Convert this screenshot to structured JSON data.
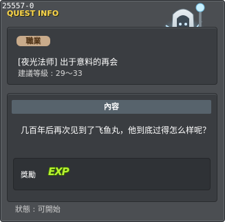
{
  "quest": {
    "id": "25557-0",
    "header_label": "QUEST INFO",
    "job_badge": "職業",
    "name": "[夜光法师] 出于意料的再会",
    "recommended_level": "建議等級 : 29～33"
  },
  "content": {
    "header": "內容",
    "description": "几百年后再次见到了飞鱼丸，他到底过得怎么样呢？",
    "reward_label": "獎勵",
    "reward_icon_text": "EXP"
  },
  "status": {
    "text": "狀態 :  可開始"
  },
  "npc": {
    "icon": "hooded-sage-npc-icon"
  },
  "colors": {
    "header_label": "#ffd84a",
    "job_badge_bg": "#c9ab8b",
    "exp_green": "#b8f230",
    "panel_bg": "#3a3d41"
  }
}
